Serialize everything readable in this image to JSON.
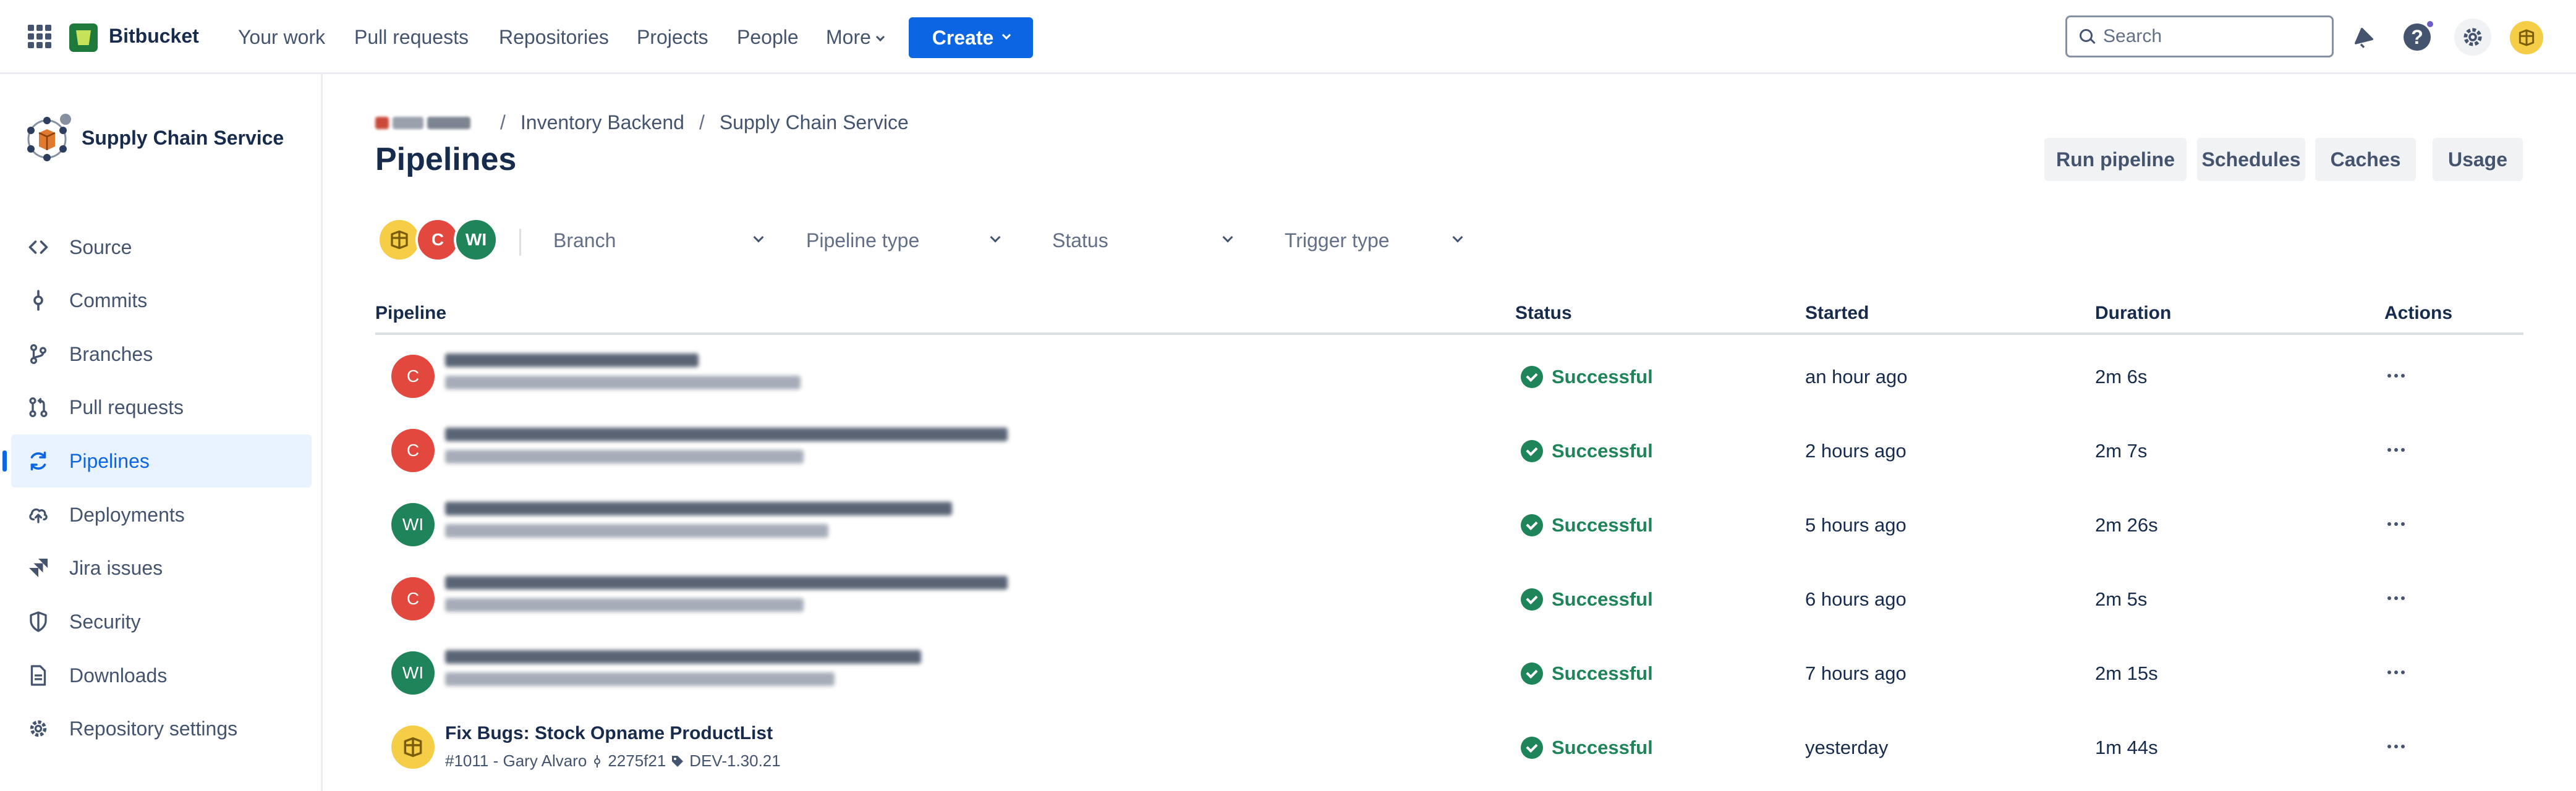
{
  "topnav": {
    "brand": "Bitbucket",
    "links": [
      "Your work",
      "Pull requests",
      "Repositories",
      "Projects",
      "People",
      "More"
    ],
    "create_label": "Create",
    "search_placeholder": "Search",
    "help_label": "?",
    "icons": {
      "apps": "app-switcher-icon",
      "notifications": "notification-bell-icon",
      "help": "help-icon",
      "settings": "gear-icon",
      "profile": "profile-avatar-icon"
    }
  },
  "sidebar": {
    "repo_name": "Supply Chain Service",
    "items": [
      {
        "label": "Source",
        "icon": "code-icon"
      },
      {
        "label": "Commits",
        "icon": "commit-icon"
      },
      {
        "label": "Branches",
        "icon": "branch-icon"
      },
      {
        "label": "Pull requests",
        "icon": "pull-request-icon"
      },
      {
        "label": "Pipelines",
        "icon": "pipelines-icon",
        "active": true
      },
      {
        "label": "Deployments",
        "icon": "cloud-upload-icon"
      },
      {
        "label": "Jira issues",
        "icon": "jira-icon"
      },
      {
        "label": "Security",
        "icon": "shield-icon"
      },
      {
        "label": "Downloads",
        "icon": "document-icon"
      },
      {
        "label": "Repository settings",
        "icon": "gear-icon"
      }
    ]
  },
  "breadcrumb": [
    "Inventory Backend",
    "Supply Chain Service"
  ],
  "page_title": "Pipelines",
  "header_buttons": [
    "Run pipeline",
    "Schedules",
    "Caches",
    "Usage"
  ],
  "filters": {
    "avatars": [
      {
        "initials": "",
        "color": "#f5cd47"
      },
      {
        "initials": "C",
        "color": "#e2483d"
      },
      {
        "initials": "WI",
        "color": "#1f845a"
      }
    ],
    "dropdowns": [
      "Branch",
      "Pipeline type",
      "Status",
      "Trigger type"
    ]
  },
  "table": {
    "columns": [
      "Pipeline",
      "Status",
      "Started",
      "Duration",
      "Actions"
    ],
    "rows": [
      {
        "avatar": "C",
        "avatar_color": "#e2483d",
        "status": "Successful",
        "started": "an hour ago",
        "duration": "2m 6s"
      },
      {
        "avatar": "C",
        "avatar_color": "#e2483d",
        "status": "Successful",
        "started": "2 hours ago",
        "duration": "2m 7s"
      },
      {
        "avatar": "WI",
        "avatar_color": "#1f845a",
        "status": "Successful",
        "started": "5 hours ago",
        "duration": "2m 26s"
      },
      {
        "avatar": "C",
        "avatar_color": "#e2483d",
        "status": "Successful",
        "started": "6 hours ago",
        "duration": "2m 5s"
      },
      {
        "avatar": "WI",
        "avatar_color": "#1f845a",
        "status": "Successful",
        "started": "7 hours ago",
        "duration": "2m 15s"
      },
      {
        "avatar": "",
        "avatar_color": "#f5cd47",
        "title": "Fix Bugs: Stock Opname ProductList",
        "meta_id": "#1011 - Gary Alvaro",
        "meta_commit": "2275f21",
        "meta_tag": "DEV-1.30.21",
        "status": "Successful",
        "started": "yesterday",
        "duration": "1m 44s"
      }
    ]
  },
  "colors": {
    "accent": "#0c66e4",
    "success": "#1f845a",
    "brand": "#1d7a3a"
  }
}
